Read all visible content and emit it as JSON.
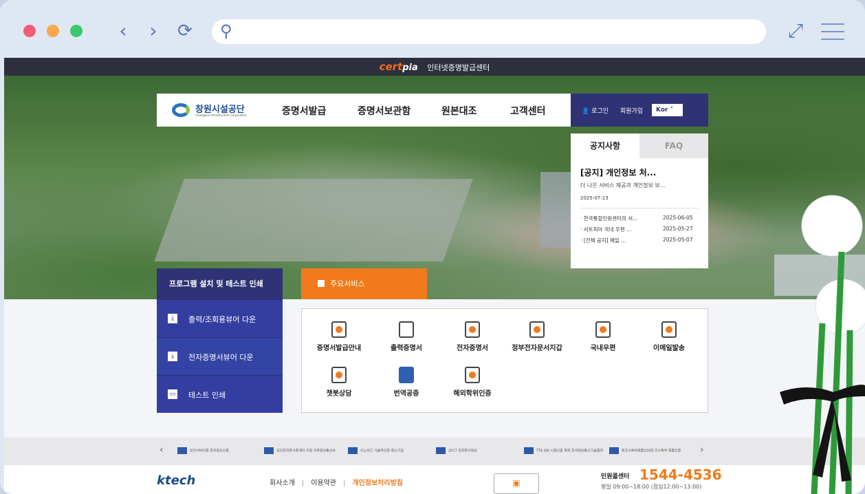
{
  "browser": {
    "nav_back": "‹",
    "nav_forward": "›",
    "reload": "⟳",
    "search_glyph": "⚲",
    "expand": "⤢"
  },
  "certbar": {
    "brand": "cert",
    "brand_suffix": "pia",
    "title": "인터넷증명발급센터"
  },
  "gnb": {
    "org_name": "창원시설공단",
    "org_en": "Changwon Infrastructure Corporation",
    "menu": [
      "증명서발급",
      "증명서보관함",
      "원본대조",
      "고객센터"
    ],
    "login": "로그인",
    "join": "회원가입",
    "lang": "Kor ˅"
  },
  "notice": {
    "tab_notice": "공지사항",
    "tab_faq": "FAQ",
    "featured_title": "[공지] 개인정보 처...",
    "featured_desc": "더 나은 서비스 제공과 개인정보 보...",
    "featured_date": "2025-07-23",
    "items": [
      {
        "title": "· 한국통합민원센터의 서...",
        "date": "2025-06-05"
      },
      {
        "title": "· 서트피아 국내 우편 ...",
        "date": "2025-05-27"
      },
      {
        "title": "· [전체 공지] 메일 ...",
        "date": "2025-05-07"
      }
    ]
  },
  "program": {
    "header": "프로그램 설치 및 테스트 인쇄",
    "items": [
      "출력/조회용뷰어 다운",
      "전자증명서뷰어 다운",
      "테스트 인쇄"
    ]
  },
  "services": {
    "tab": "주요서비스",
    "items": [
      "증명서발급안내",
      "출력증명서",
      "전자증명서",
      "정부전자문서지갑",
      "국내우편",
      "이메일발송",
      "챗봇상담",
      "번역공증",
      "해외학위인증"
    ]
  },
  "partners": [
    "보안서버인증 한국정보인증",
    "공인전자문서중계자 지정 과학정보통신부",
    "이노비즈 기술혁신형 중소기업",
    "2017 전자문서대상",
    "TTA SW 시험인증 획득 한국정보통신기술협회",
    "최우수특허제품100대 우수특허 제품인증"
  ],
  "footer": {
    "brand": "ktech",
    "links": [
      "회사소개",
      "이용약관",
      "개인정보처리방침"
    ],
    "cc_label": "민원콜센터",
    "phone": "1544-4536",
    "hours": "평일 09:00~18:00 (점심12:00~13:00)"
  }
}
